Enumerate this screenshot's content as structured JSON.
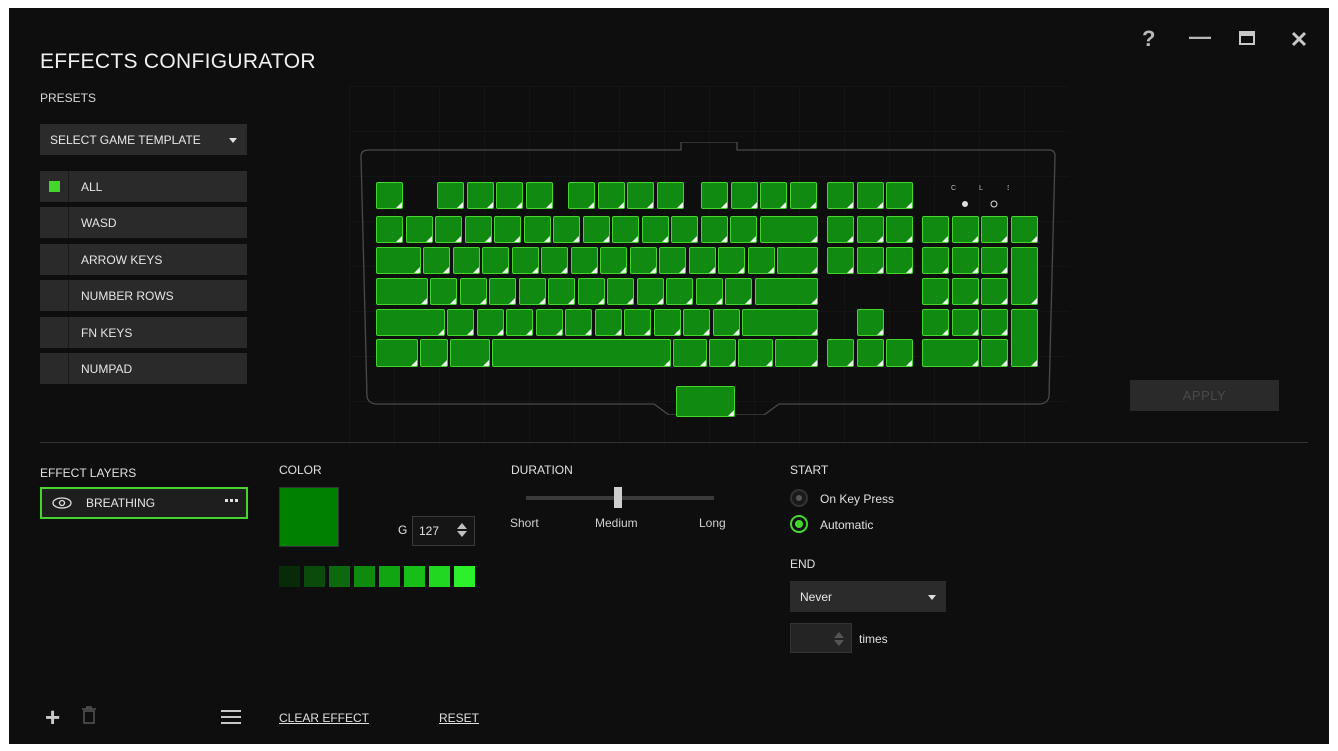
{
  "window": {
    "title": "EFFECTS CONFIGURATOR",
    "help_glyph": "?",
    "minimize_glyph": "—",
    "maximize_glyph": "□",
    "close_glyph": "✕"
  },
  "presets": {
    "label": "PRESETS",
    "template_select": "SELECT GAME TEMPLATE",
    "items": [
      {
        "label": "ALL",
        "checked": true
      },
      {
        "label": "WASD",
        "checked": false
      },
      {
        "label": "ARROW KEYS",
        "checked": false
      },
      {
        "label": "NUMBER ROWS",
        "checked": false
      },
      {
        "label": "FN KEYS",
        "checked": false
      },
      {
        "label": "NUMPAD",
        "checked": false
      }
    ]
  },
  "keyboard": {
    "led_labels": [
      "C",
      "L",
      "S"
    ],
    "key_color": "#118a11",
    "outline_color": "#44d62c"
  },
  "apply_label": "APPLY",
  "effect_layers": {
    "label": "EFFECT LAYERS",
    "items": [
      {
        "label": "BREATHING",
        "visible": true,
        "selected": true
      }
    ]
  },
  "color": {
    "label": "COLOR",
    "current_hex": "#008000",
    "channel_label": "G",
    "channel_value": "127",
    "shades": [
      "#062b06",
      "#0a4a0a",
      "#0d690d",
      "#0f8a0f",
      "#12a512",
      "#17be17",
      "#1fd81f",
      "#2cf02c"
    ]
  },
  "duration": {
    "label": "DURATION",
    "ticks": [
      "Short",
      "Medium",
      "Long"
    ],
    "selected": "Medium"
  },
  "start": {
    "label": "START",
    "options": [
      {
        "label": "On Key Press",
        "selected": false
      },
      {
        "label": "Automatic",
        "selected": true
      }
    ]
  },
  "end": {
    "label": "END",
    "selected": "Never",
    "times_label": "times"
  },
  "footer": {
    "add_glyph": "+",
    "clear_effect": "CLEAR EFFECT",
    "reset": "RESET"
  },
  "accent": "#44d62c"
}
